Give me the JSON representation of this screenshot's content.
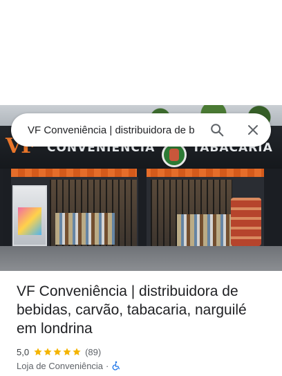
{
  "search": {
    "query": "VF Conveniência | distribuidora de b"
  },
  "photo": {
    "sign_vf": "VF",
    "sign_conveniencia": "CONVENIÊNCIA",
    "sign_tabacaria": "TABACARIA"
  },
  "place": {
    "title": "VF Conveniência | distribuidora de bebidas, carvão, tabacaria, narguilé em londrina",
    "rating": "5,0",
    "stars": 5,
    "review_count": "(89)",
    "category": "Loja de Conveniência",
    "separator": "·",
    "accessibility_icon": "wheelchair-icon"
  },
  "colors": {
    "star": "#f4b400",
    "accessibility": "#1a73e8",
    "awning": "#e56d2a"
  }
}
